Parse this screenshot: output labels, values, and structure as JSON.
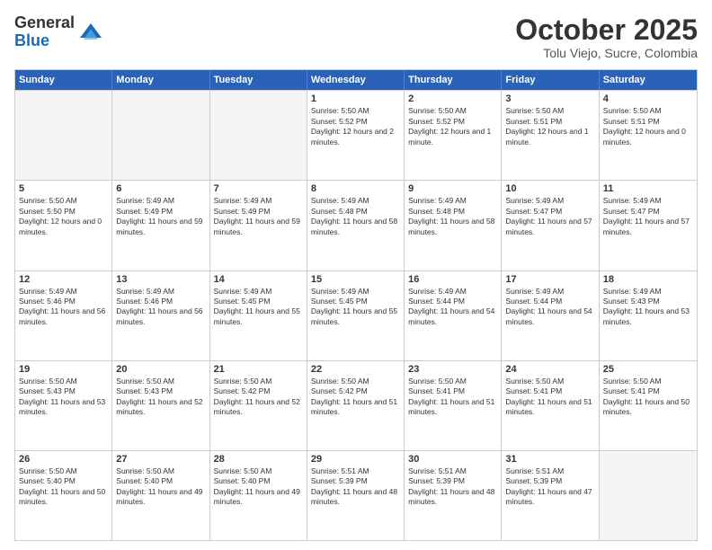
{
  "logo": {
    "general": "General",
    "blue": "Blue"
  },
  "header": {
    "month": "October 2025",
    "location": "Tolu Viejo, Sucre, Colombia"
  },
  "weekdays": [
    "Sunday",
    "Monday",
    "Tuesday",
    "Wednesday",
    "Thursday",
    "Friday",
    "Saturday"
  ],
  "weeks": [
    [
      {
        "day": "",
        "sunrise": "",
        "sunset": "",
        "daylight": "",
        "empty": true
      },
      {
        "day": "",
        "sunrise": "",
        "sunset": "",
        "daylight": "",
        "empty": true
      },
      {
        "day": "",
        "sunrise": "",
        "sunset": "",
        "daylight": "",
        "empty": true
      },
      {
        "day": "1",
        "sunrise": "Sunrise: 5:50 AM",
        "sunset": "Sunset: 5:52 PM",
        "daylight": "Daylight: 12 hours and 2 minutes."
      },
      {
        "day": "2",
        "sunrise": "Sunrise: 5:50 AM",
        "sunset": "Sunset: 5:52 PM",
        "daylight": "Daylight: 12 hours and 1 minute."
      },
      {
        "day": "3",
        "sunrise": "Sunrise: 5:50 AM",
        "sunset": "Sunset: 5:51 PM",
        "daylight": "Daylight: 12 hours and 1 minute."
      },
      {
        "day": "4",
        "sunrise": "Sunrise: 5:50 AM",
        "sunset": "Sunset: 5:51 PM",
        "daylight": "Daylight: 12 hours and 0 minutes."
      }
    ],
    [
      {
        "day": "5",
        "sunrise": "Sunrise: 5:50 AM",
        "sunset": "Sunset: 5:50 PM",
        "daylight": "Daylight: 12 hours and 0 minutes."
      },
      {
        "day": "6",
        "sunrise": "Sunrise: 5:49 AM",
        "sunset": "Sunset: 5:49 PM",
        "daylight": "Daylight: 11 hours and 59 minutes."
      },
      {
        "day": "7",
        "sunrise": "Sunrise: 5:49 AM",
        "sunset": "Sunset: 5:49 PM",
        "daylight": "Daylight: 11 hours and 59 minutes."
      },
      {
        "day": "8",
        "sunrise": "Sunrise: 5:49 AM",
        "sunset": "Sunset: 5:48 PM",
        "daylight": "Daylight: 11 hours and 58 minutes."
      },
      {
        "day": "9",
        "sunrise": "Sunrise: 5:49 AM",
        "sunset": "Sunset: 5:48 PM",
        "daylight": "Daylight: 11 hours and 58 minutes."
      },
      {
        "day": "10",
        "sunrise": "Sunrise: 5:49 AM",
        "sunset": "Sunset: 5:47 PM",
        "daylight": "Daylight: 11 hours and 57 minutes."
      },
      {
        "day": "11",
        "sunrise": "Sunrise: 5:49 AM",
        "sunset": "Sunset: 5:47 PM",
        "daylight": "Daylight: 11 hours and 57 minutes."
      }
    ],
    [
      {
        "day": "12",
        "sunrise": "Sunrise: 5:49 AM",
        "sunset": "Sunset: 5:46 PM",
        "daylight": "Daylight: 11 hours and 56 minutes."
      },
      {
        "day": "13",
        "sunrise": "Sunrise: 5:49 AM",
        "sunset": "Sunset: 5:46 PM",
        "daylight": "Daylight: 11 hours and 56 minutes."
      },
      {
        "day": "14",
        "sunrise": "Sunrise: 5:49 AM",
        "sunset": "Sunset: 5:45 PM",
        "daylight": "Daylight: 11 hours and 55 minutes."
      },
      {
        "day": "15",
        "sunrise": "Sunrise: 5:49 AM",
        "sunset": "Sunset: 5:45 PM",
        "daylight": "Daylight: 11 hours and 55 minutes."
      },
      {
        "day": "16",
        "sunrise": "Sunrise: 5:49 AM",
        "sunset": "Sunset: 5:44 PM",
        "daylight": "Daylight: 11 hours and 54 minutes."
      },
      {
        "day": "17",
        "sunrise": "Sunrise: 5:49 AM",
        "sunset": "Sunset: 5:44 PM",
        "daylight": "Daylight: 11 hours and 54 minutes."
      },
      {
        "day": "18",
        "sunrise": "Sunrise: 5:49 AM",
        "sunset": "Sunset: 5:43 PM",
        "daylight": "Daylight: 11 hours and 53 minutes."
      }
    ],
    [
      {
        "day": "19",
        "sunrise": "Sunrise: 5:50 AM",
        "sunset": "Sunset: 5:43 PM",
        "daylight": "Daylight: 11 hours and 53 minutes."
      },
      {
        "day": "20",
        "sunrise": "Sunrise: 5:50 AM",
        "sunset": "Sunset: 5:43 PM",
        "daylight": "Daylight: 11 hours and 52 minutes."
      },
      {
        "day": "21",
        "sunrise": "Sunrise: 5:50 AM",
        "sunset": "Sunset: 5:42 PM",
        "daylight": "Daylight: 11 hours and 52 minutes."
      },
      {
        "day": "22",
        "sunrise": "Sunrise: 5:50 AM",
        "sunset": "Sunset: 5:42 PM",
        "daylight": "Daylight: 11 hours and 51 minutes."
      },
      {
        "day": "23",
        "sunrise": "Sunrise: 5:50 AM",
        "sunset": "Sunset: 5:41 PM",
        "daylight": "Daylight: 11 hours and 51 minutes."
      },
      {
        "day": "24",
        "sunrise": "Sunrise: 5:50 AM",
        "sunset": "Sunset: 5:41 PM",
        "daylight": "Daylight: 11 hours and 51 minutes."
      },
      {
        "day": "25",
        "sunrise": "Sunrise: 5:50 AM",
        "sunset": "Sunset: 5:41 PM",
        "daylight": "Daylight: 11 hours and 50 minutes."
      }
    ],
    [
      {
        "day": "26",
        "sunrise": "Sunrise: 5:50 AM",
        "sunset": "Sunset: 5:40 PM",
        "daylight": "Daylight: 11 hours and 50 minutes."
      },
      {
        "day": "27",
        "sunrise": "Sunrise: 5:50 AM",
        "sunset": "Sunset: 5:40 PM",
        "daylight": "Daylight: 11 hours and 49 minutes."
      },
      {
        "day": "28",
        "sunrise": "Sunrise: 5:50 AM",
        "sunset": "Sunset: 5:40 PM",
        "daylight": "Daylight: 11 hours and 49 minutes."
      },
      {
        "day": "29",
        "sunrise": "Sunrise: 5:51 AM",
        "sunset": "Sunset: 5:39 PM",
        "daylight": "Daylight: 11 hours and 48 minutes."
      },
      {
        "day": "30",
        "sunrise": "Sunrise: 5:51 AM",
        "sunset": "Sunset: 5:39 PM",
        "daylight": "Daylight: 11 hours and 48 minutes."
      },
      {
        "day": "31",
        "sunrise": "Sunrise: 5:51 AM",
        "sunset": "Sunset: 5:39 PM",
        "daylight": "Daylight: 11 hours and 47 minutes."
      },
      {
        "day": "",
        "sunrise": "",
        "sunset": "",
        "daylight": "",
        "empty": true
      }
    ]
  ]
}
